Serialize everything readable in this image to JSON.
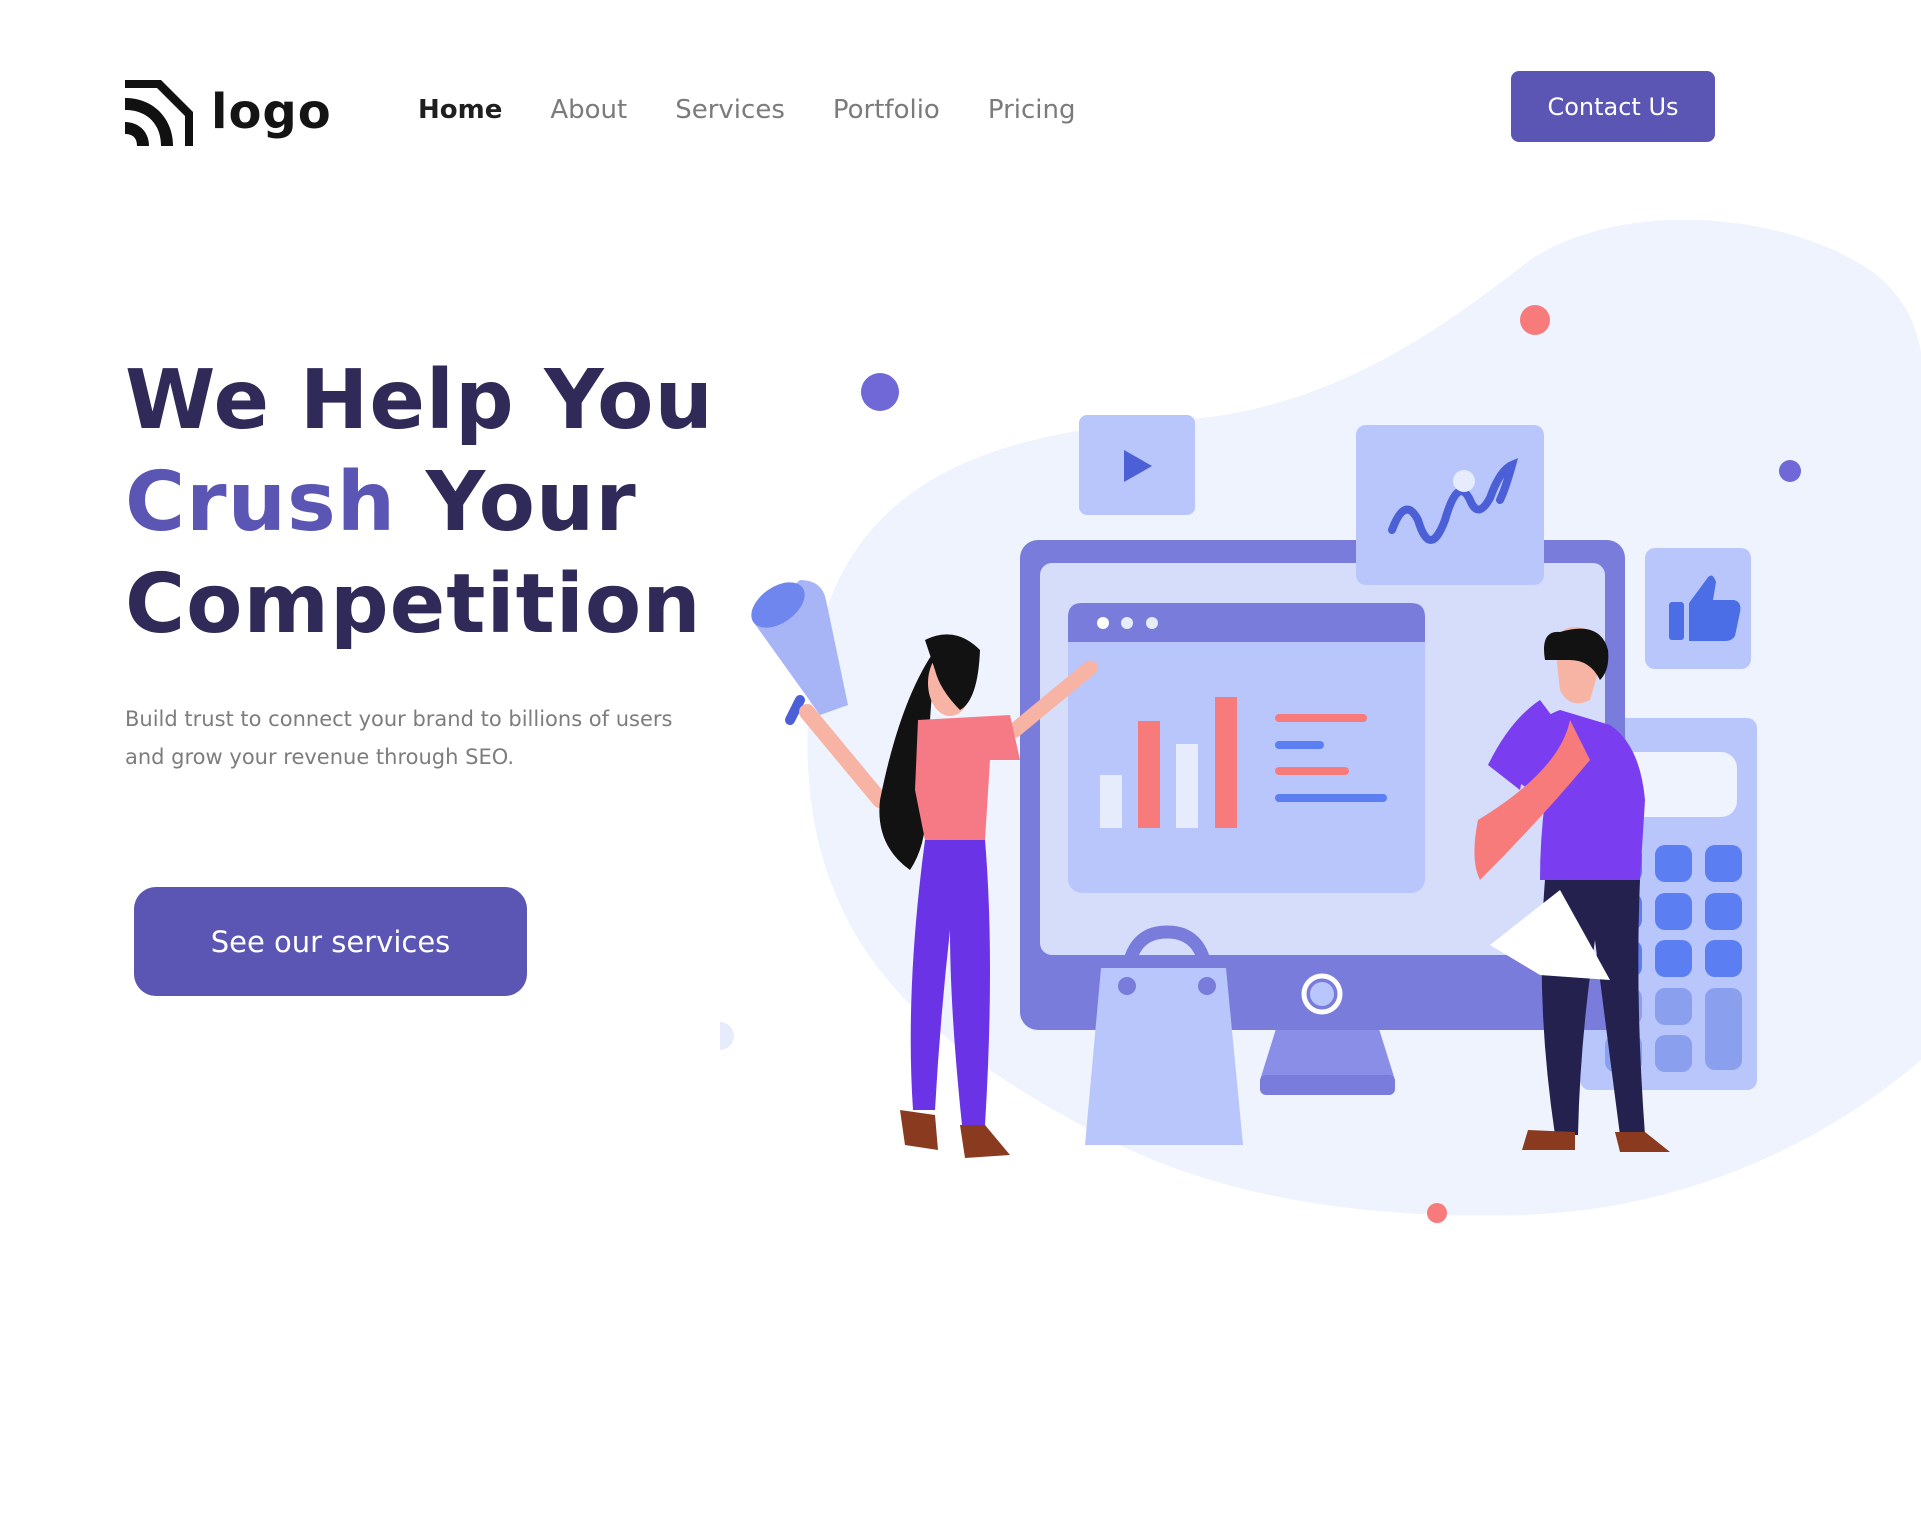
{
  "brand": {
    "logo_text": "logo"
  },
  "nav": {
    "items": [
      {
        "label": "Home",
        "active": true
      },
      {
        "label": "About",
        "active": false
      },
      {
        "label": "Services",
        "active": false
      },
      {
        "label": "Portfolio",
        "active": false
      },
      {
        "label": "Pricing",
        "active": false
      }
    ]
  },
  "header": {
    "contact_label": "Contact Us"
  },
  "hero": {
    "line1": "We Help You",
    "line2_accent": "Crush",
    "line2_rest": " Your",
    "line3": "Competition",
    "subtitle": "Build trust to connect your brand to billions of users and grow your revenue through SEO.",
    "cta_label": "See our services"
  },
  "colors": {
    "primary": "#5b55b3",
    "heading": "#2f2a57",
    "text_muted": "#7d7d7d",
    "accent_coral": "#f77b7b",
    "illustration_light": "#eef3fd",
    "illustration_mid": "#b9c6fb"
  },
  "icons": [
    "logo-mark-icon",
    "play-icon",
    "trend-chart-icon",
    "thumbs-up-icon",
    "megaphone-icon",
    "shopping-bag-icon"
  ]
}
